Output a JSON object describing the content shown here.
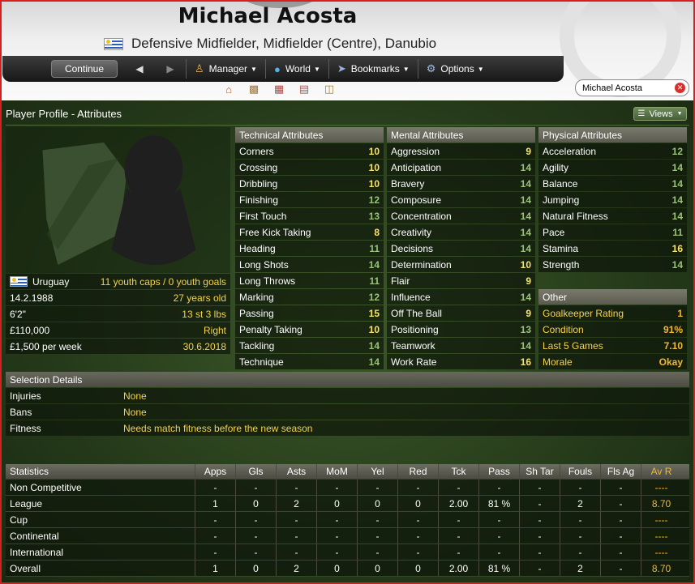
{
  "header": {
    "player_name": "Michael Acosta",
    "subtitle": "Defensive Midfielder, Midfielder (Centre), Danubio"
  },
  "toolbar": {
    "continue_label": "Continue",
    "back_icon": "◀",
    "forward_icon": "▶",
    "menus": [
      {
        "label": "Manager",
        "icon": "manager-icon"
      },
      {
        "label": "World",
        "icon": "globe-icon"
      },
      {
        "label": "Bookmarks",
        "icon": "bookmark-icon"
      },
      {
        "label": "Options",
        "icon": "gear-icon"
      }
    ],
    "quick_icons": [
      "home-icon",
      "inbox-icon",
      "calendar-icon",
      "news-icon",
      "notes-icon"
    ]
  },
  "search": {
    "value": "Michael Acosta"
  },
  "panel": {
    "title": "Player Profile - Attributes",
    "views_label": "Views"
  },
  "profile": {
    "nationality": "Uruguay",
    "caps": "11 youth caps / 0 youth goals",
    "dob": "14.2.1988",
    "age": "27 years old",
    "height": "6'2\"",
    "weight": "13 st 3 lbs",
    "value": "£110,000",
    "foot": "Right",
    "wage": "£1,500 per week",
    "contract_end": "30.6.2018"
  },
  "technical": {
    "header": "Technical Attributes",
    "items": [
      {
        "label": "Corners",
        "value": "10"
      },
      {
        "label": "Crossing",
        "value": "10"
      },
      {
        "label": "Dribbling",
        "value": "10"
      },
      {
        "label": "Finishing",
        "value": "12"
      },
      {
        "label": "First Touch",
        "value": "13"
      },
      {
        "label": "Free Kick Taking",
        "value": "8"
      },
      {
        "label": "Heading",
        "value": "11"
      },
      {
        "label": "Long Shots",
        "value": "14"
      },
      {
        "label": "Long Throws",
        "value": "11"
      },
      {
        "label": "Marking",
        "value": "12"
      },
      {
        "label": "Passing",
        "value": "15"
      },
      {
        "label": "Penalty Taking",
        "value": "10"
      },
      {
        "label": "Tackling",
        "value": "14"
      },
      {
        "label": "Technique",
        "value": "14"
      }
    ]
  },
  "mental": {
    "header": "Mental Attributes",
    "items": [
      {
        "label": "Aggression",
        "value": "9"
      },
      {
        "label": "Anticipation",
        "value": "14"
      },
      {
        "label": "Bravery",
        "value": "14"
      },
      {
        "label": "Composure",
        "value": "14"
      },
      {
        "label": "Concentration",
        "value": "14"
      },
      {
        "label": "Creativity",
        "value": "14"
      },
      {
        "label": "Decisions",
        "value": "14"
      },
      {
        "label": "Determination",
        "value": "10"
      },
      {
        "label": "Flair",
        "value": "9"
      },
      {
        "label": "Influence",
        "value": "14"
      },
      {
        "label": "Off The Ball",
        "value": "9"
      },
      {
        "label": "Positioning",
        "value": "13"
      },
      {
        "label": "Teamwork",
        "value": "14"
      },
      {
        "label": "Work Rate",
        "value": "16"
      }
    ]
  },
  "physical": {
    "header": "Physical Attributes",
    "items": [
      {
        "label": "Acceleration",
        "value": "12"
      },
      {
        "label": "Agility",
        "value": "14"
      },
      {
        "label": "Balance",
        "value": "14"
      },
      {
        "label": "Jumping",
        "value": "14"
      },
      {
        "label": "Natural Fitness",
        "value": "14"
      },
      {
        "label": "Pace",
        "value": "11"
      },
      {
        "label": "Stamina",
        "value": "16"
      },
      {
        "label": "Strength",
        "value": "14"
      }
    ]
  },
  "other": {
    "header": "Other",
    "items": [
      {
        "label": "Goalkeeper Rating",
        "value": "1"
      },
      {
        "label": "Condition",
        "value": "91%"
      },
      {
        "label": "Last 5 Games",
        "value": "7.10"
      },
      {
        "label": "Morale",
        "value": "Okay"
      }
    ]
  },
  "selection": {
    "header": "Selection Details",
    "rows": [
      {
        "label": "Injuries",
        "value": "None"
      },
      {
        "label": "Bans",
        "value": "None"
      },
      {
        "label": "Fitness",
        "value": "Needs match fitness before the new season"
      }
    ]
  },
  "statistics": {
    "headers": [
      "Statistics",
      "Apps",
      "Gls",
      "Asts",
      "MoM",
      "Yel",
      "Red",
      "Tck",
      "Pass",
      "Sh Tar",
      "Fouls",
      "Fls Ag",
      "Av R"
    ],
    "rows": [
      [
        "Non Competitive",
        "-",
        "-",
        "-",
        "-",
        "-",
        "-",
        "-",
        "-",
        "-",
        "-",
        "-",
        "----"
      ],
      [
        "League",
        "1",
        "0",
        "2",
        "0",
        "0",
        "0",
        "2.00",
        "81 %",
        "-",
        "2",
        "-",
        "8.70"
      ],
      [
        "Cup",
        "-",
        "-",
        "-",
        "-",
        "-",
        "-",
        "-",
        "-",
        "-",
        "-",
        "-",
        "----"
      ],
      [
        "Continental",
        "-",
        "-",
        "-",
        "-",
        "-",
        "-",
        "-",
        "-",
        "-",
        "-",
        "-",
        "----"
      ],
      [
        "International",
        "-",
        "-",
        "-",
        "-",
        "-",
        "-",
        "-",
        "-",
        "-",
        "-",
        "-",
        "----"
      ],
      [
        "Overall",
        "1",
        "0",
        "2",
        "0",
        "0",
        "0",
        "2.00",
        "81 %",
        "-",
        "2",
        "-",
        "8.70"
      ]
    ]
  },
  "colors": {
    "highlight_yellow": "#f5e36a",
    "attribute_green": "#9ac27c",
    "avr_orange": "#f2b632",
    "frame_red": "#d42020"
  }
}
